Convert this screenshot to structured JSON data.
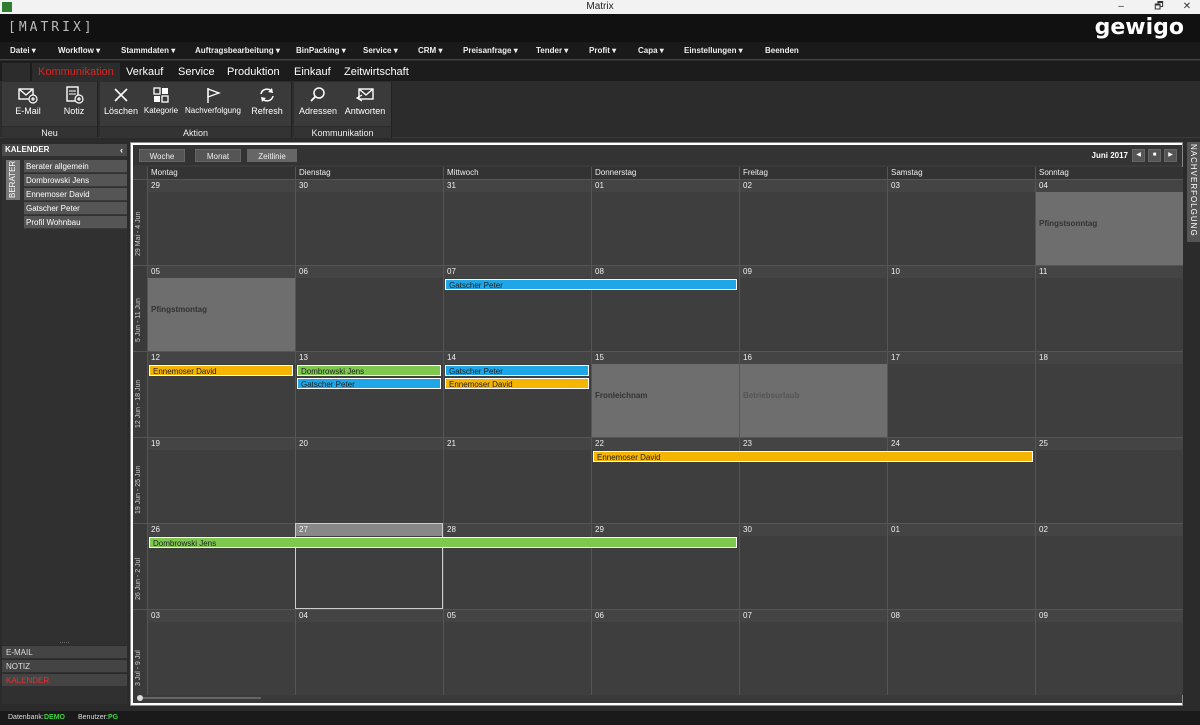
{
  "window": {
    "title": "Matrix",
    "minimize": "–",
    "maximize": "🗗",
    "close": "✕"
  },
  "header": {
    "logo": "[MATRIX]",
    "brand": "gewigo"
  },
  "menu": [
    "Datei ▾",
    "Workflow ▾",
    "Stammdaten ▾",
    "Auftragsbearbeitung ▾",
    "BinPacking ▾",
    "Service ▾",
    "CRM ▾",
    "Preisanfrage ▾",
    "Tender ▾",
    "Profit ▾",
    "Capa ▾",
    "Einstellungen ▾",
    "Beenden"
  ],
  "tabs": [
    "Kommunikation",
    "Verkauf",
    "Service",
    "Produktion",
    "Einkauf",
    "Zeitwirtschaft"
  ],
  "active_tab": "Kommunikation",
  "ribbon": {
    "groups": [
      {
        "label": "Neu",
        "buttons": [
          {
            "label": "E-Mail",
            "icon": "mail-plus-icon"
          },
          {
            "label": "Notiz",
            "icon": "note-plus-icon"
          }
        ]
      },
      {
        "label": "Aktion",
        "buttons": [
          {
            "label": "Löschen",
            "icon": "close-icon"
          },
          {
            "label": "Kategorie",
            "icon": "category-icon"
          },
          {
            "label": "Nachverfolgung",
            "icon": "flag-icon"
          },
          {
            "label": "Refresh",
            "icon": "refresh-icon"
          }
        ]
      },
      {
        "label": "Kommunikation",
        "buttons": [
          {
            "label": "Adressen",
            "icon": "search-icon"
          },
          {
            "label": "Antworten",
            "icon": "reply-mail-icon"
          }
        ]
      }
    ]
  },
  "left_panel": {
    "title": "KALENDER",
    "vertical_tab": "BERATER",
    "items": [
      "Berater allgemein",
      "Dombrowski Jens",
      "Ennemoser David",
      "Gatscher Peter",
      "Profil Wohnbau"
    ],
    "bottom": [
      "E-MAIL",
      "NOTIZ",
      "KALENDER"
    ],
    "bottom_active": "KALENDER",
    "grip": "....."
  },
  "calendar": {
    "views": [
      "Woche",
      "Monat",
      "Zeitlinie"
    ],
    "month_label": "Juni 2017",
    "nav": [
      "◀",
      "■",
      "▶"
    ],
    "weekdays": [
      "Montag",
      "Dienstag",
      "Mittwoch",
      "Donnerstag",
      "Freitag",
      "Samstag",
      "Sonntag"
    ],
    "weeks": [
      {
        "label": "29 Mai - 4 Jun",
        "days": [
          "29",
          "30",
          "31",
          "01",
          "02",
          "03",
          "04"
        ]
      },
      {
        "label": "5 Jun - 11 Jun",
        "days": [
          "05",
          "06",
          "07",
          "08",
          "09",
          "10",
          "11"
        ]
      },
      {
        "label": "12 Jun - 18 Jun",
        "days": [
          "12",
          "13",
          "14",
          "15",
          "16",
          "17",
          "18"
        ]
      },
      {
        "label": "19 Jun - 25 Jun",
        "days": [
          "19",
          "20",
          "21",
          "22",
          "23",
          "24",
          "25"
        ]
      },
      {
        "label": "26 Jun - 2 Jul",
        "days": [
          "26",
          "27",
          "28",
          "29",
          "30",
          "01",
          "02"
        ]
      },
      {
        "label": "3 Jul - 9 Jul",
        "days": [
          "03",
          "04",
          "05",
          "06",
          "07",
          "08",
          "09"
        ]
      }
    ],
    "holidays": [
      {
        "week": 0,
        "day": 6,
        "name": "Pfingstsonntag"
      },
      {
        "week": 1,
        "day": 0,
        "name": "Pfingstmontag"
      },
      {
        "week": 2,
        "day": 3,
        "name": "Fronleichnam"
      },
      {
        "week": 2,
        "day": 4,
        "name": "Betriebsurlaub"
      }
    ],
    "events": [
      {
        "week": 1,
        "start": 2,
        "span": 2,
        "row": 0,
        "name": "Gatscher Peter",
        "color": "blue"
      },
      {
        "week": 2,
        "start": 0,
        "span": 1,
        "row": 0,
        "name": "Ennemoser David",
        "color": "yellow"
      },
      {
        "week": 2,
        "start": 1,
        "span": 1,
        "row": 0,
        "name": "Dombrowski Jens",
        "color": "green"
      },
      {
        "week": 2,
        "start": 1,
        "span": 1,
        "row": 1,
        "name": "Gatscher Peter",
        "color": "blue"
      },
      {
        "week": 2,
        "start": 2,
        "span": 1,
        "row": 0,
        "name": "Gatscher Peter",
        "color": "blue"
      },
      {
        "week": 2,
        "start": 2,
        "span": 1,
        "row": 1,
        "name": "Ennemoser David",
        "color": "yellow"
      },
      {
        "week": 3,
        "start": 3,
        "span": 3,
        "row": 0,
        "name": "Ennemoser David",
        "color": "yellow"
      },
      {
        "week": 4,
        "start": 0,
        "span": 4,
        "row": 0,
        "name": "Dombrowski Jens",
        "color": "green"
      }
    ],
    "today": {
      "week": 4,
      "day": 1
    }
  },
  "right_tab": "NACHVERFOLGUNG",
  "status": {
    "db_label": "Datenbank:",
    "db_value": "DEMO",
    "user_label": "Benutzer:",
    "user_value": "PG"
  },
  "colors": {
    "accent": "#e02020",
    "yellow": "#f5b400",
    "green": "#7ec850",
    "blue": "#1ea6e6",
    "status_value": "#3fd23f"
  }
}
